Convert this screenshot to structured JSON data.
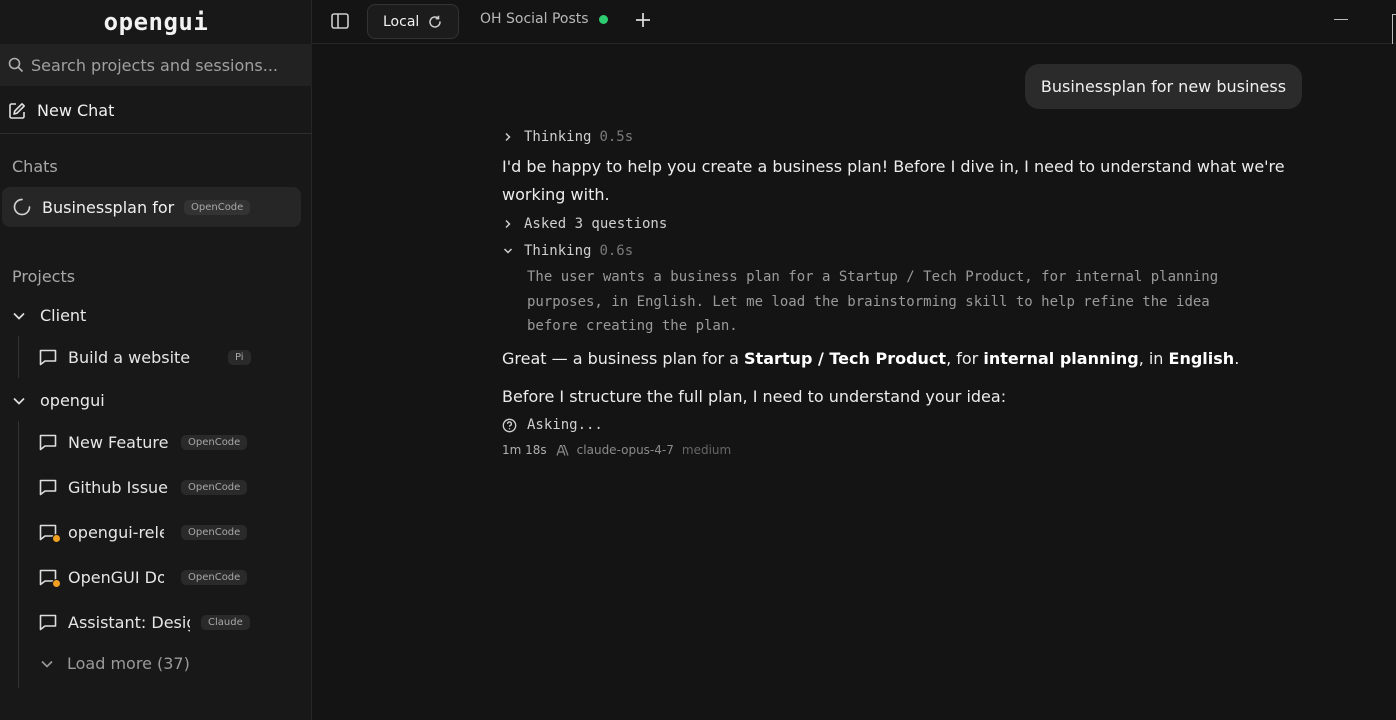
{
  "sidebar": {
    "logo": "opengui",
    "search_placeholder": "Search projects and sessions...",
    "new_chat": "New Chat",
    "chats_title": "Chats",
    "chats": [
      {
        "label": "Businessplan for new business",
        "badge": "OpenCode"
      }
    ],
    "projects_title": "Projects",
    "groups": [
      {
        "name": "Client",
        "items": [
          {
            "label": "Build a website",
            "badge": "Pi"
          }
        ]
      },
      {
        "name": "opengui",
        "items": [
          {
            "label": "New Feature",
            "badge": "OpenCode"
          },
          {
            "label": "Github Issue",
            "badge": "OpenCode"
          },
          {
            "label": "opengui-release",
            "badge": "OpenCode"
          },
          {
            "label": "OpenGUI Docs",
            "badge": "OpenCode"
          },
          {
            "label": "Assistant: Design",
            "badge": "Claude"
          }
        ]
      }
    ],
    "load_more": "Load more (37)"
  },
  "topbar": {
    "tabs": [
      {
        "label": "Local"
      },
      {
        "label": "OH Social Posts"
      }
    ]
  },
  "conversation": {
    "user_message": "Businessplan for new business",
    "thinking1": {
      "label": "Thinking",
      "duration": "0.5s"
    },
    "para1_line1": "I'd be happy to help you create a business plan! Before I dive in, I need to understand what we're",
    "para1_line2": "working with.",
    "asked": "Asked 3 questions",
    "thinking2": {
      "label": "Thinking",
      "duration": "0.6s",
      "lines": [
        "The user wants a business plan for a Startup / Tech Product, for internal planning",
        "purposes, in English. Let me load the brainstorming skill to help refine the idea",
        "before creating the plan."
      ]
    },
    "great": {
      "p1": "Great — a business plan for a ",
      "b1": "Startup / Tech Product",
      "p2": ", for ",
      "b2": "internal planning",
      "p3": ", in ",
      "b3": "English",
      "p4": "."
    },
    "before": "Before I structure the full plan, I need to understand your idea:",
    "asking": "Asking...",
    "meta": {
      "time": "1m 18s",
      "model": "claude-opus-4-7",
      "effort": "medium"
    }
  },
  "colors": {
    "accent_green": "#2ecc71",
    "dot_orange": "#f0a020"
  }
}
